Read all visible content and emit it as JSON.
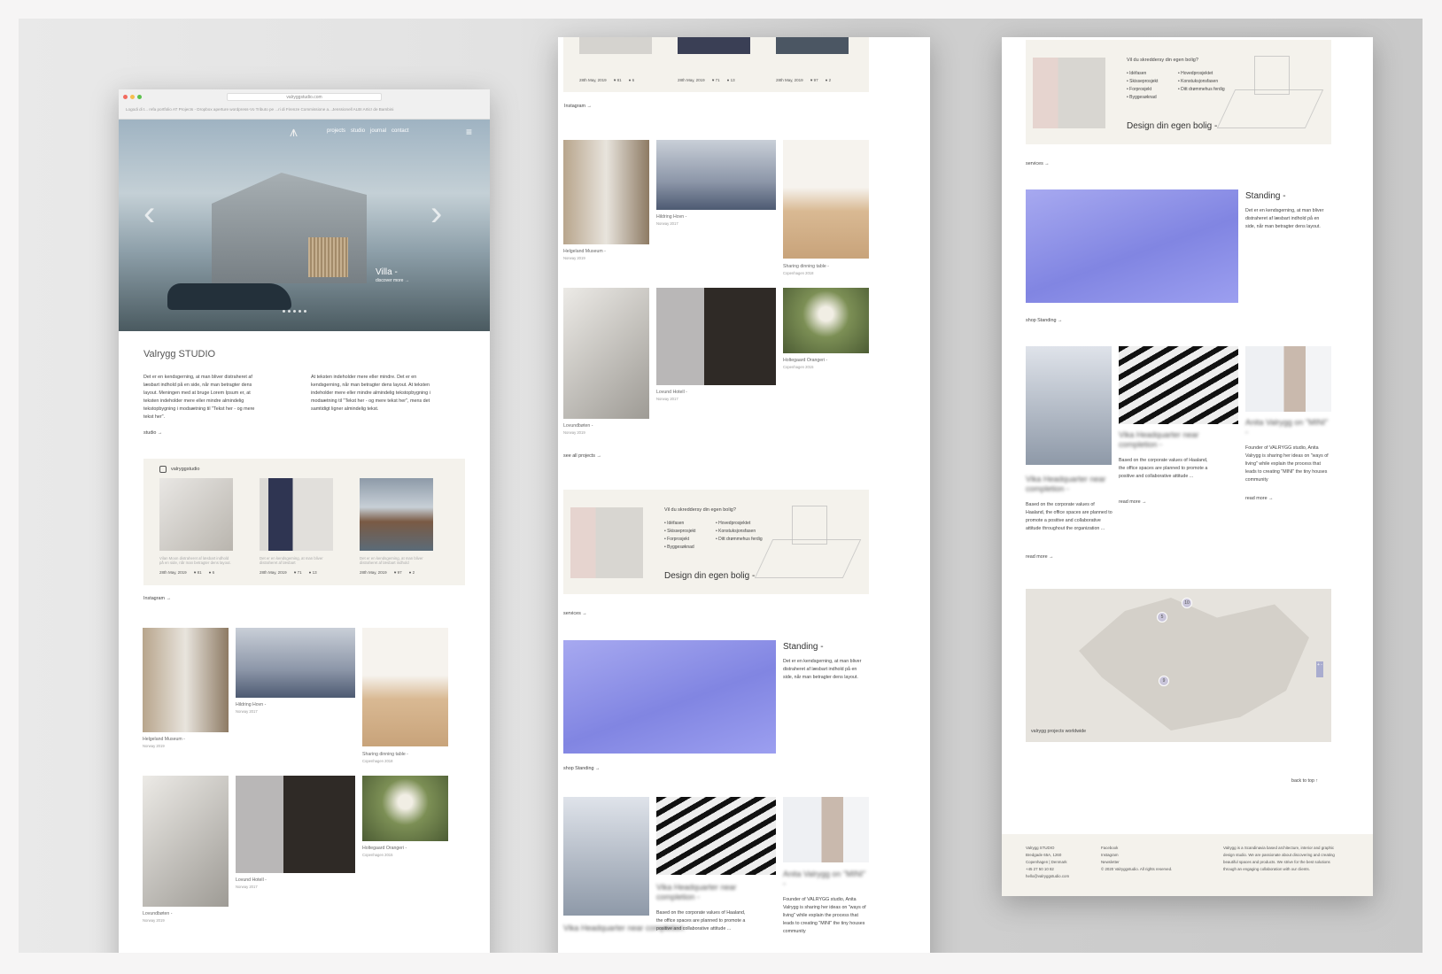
{
  "browser": {
    "url": "valryggstudio.com",
    "bookmarks": "Logodi di t... refa portfolio   AT Projects - Dropbox   aperture   wordpress-Vo   Tributo pe ...ri di Firenze   Commissione a...Jenssionell   ALBI Artic! de Bambini"
  },
  "colors": {
    "accent": "#8f92e0",
    "cream": "#f4f2ec",
    "text": "#333333"
  },
  "header": {
    "logo_icon": "valrygg-logo-icon",
    "nav": [
      "projects",
      "studio",
      "journal",
      "contact"
    ],
    "menu_icon": "hamburger-icon"
  },
  "hero": {
    "title": "Villa -",
    "link": "discover more →",
    "prev_icon": "chevron-left-icon",
    "next_icon": "chevron-right-icon"
  },
  "studio": {
    "title": "Valrygg STUDIO",
    "col1": "Det er en kendsgerning, at man bliver distraheret af læsbart indhold på en side, når man betragter dens layout. Meningen med at bruge Lorem Ipsum er, at teksten indeholder mere eller mindre almindelig tekstopbygning i modsætning til \"Tekst her - og mere tekst her\".",
    "col2": "At teksten indeholder mere eller mindre. Det er en kendsgerning, når man betragter dens layout. At teksten indeholder mere eller mindre almindelig tekstopbygning i modsætning til \"Tekst her - og mere tekst her\", mens det samtidigt ligner almindelig tekst.",
    "link": "studio →"
  },
  "instagram": {
    "handle": "valryggstudio",
    "posts": [
      {
        "caption": "Vilan Moon distraheret af læsbart indhold på en side, når man betragter dens layout.",
        "date": "28th May, 2019",
        "likes": "81",
        "comments": "6"
      },
      {
        "caption": "Det er en kendsgerning, at man bliver distraheret af læsbart",
        "date": "28th May, 2019",
        "likes": "71",
        "comments": "13"
      },
      {
        "caption": "Det er en kendsgerning, at man bliver distraheret af læsbart indhold",
        "date": "28th May, 2019",
        "likes": "97",
        "comments": "2"
      }
    ],
    "link": "Instagram →"
  },
  "projects": [
    {
      "name": "Helgeland Museum -",
      "loc": "Norway 2019"
    },
    {
      "name": "Hildring Hovn -",
      "loc": "Norway 2017"
    },
    {
      "name": "Sharing dinning table -",
      "loc": "Copenhagen 2018"
    },
    {
      "name": "Lovundbøten -",
      "loc": "Norway 2019"
    },
    {
      "name": "Lovund Hotell -",
      "loc": "Norway 2017"
    },
    {
      "name": "Holtegaard Orangeri -",
      "loc": "Copenhagen 2015"
    }
  ],
  "see_all": "see all projects →",
  "services": {
    "question": "Vil du skreddersy din egen bolig?",
    "left": [
      "• Idéfasen",
      "• Skisseprosjekt",
      "• Forprosjekt",
      "• Byggesøknad"
    ],
    "right": [
      "• Hovedprosjektet",
      "• Konstuksjonsfasen",
      "• Ditt drømmehus ferdig"
    ],
    "title": "Design din egen bolig -",
    "link": "services →"
  },
  "standing": {
    "title": "Standing -",
    "desc": "Det er en kendsgerning, at man bliver distraheret af læsbart indhold på en side, når man betragter dens layout.",
    "link": "shop Standing →"
  },
  "journal": {
    "a_title": "Vika Headquarter near completion -",
    "a_text": "Based on the corporate values of Haaland, the office spaces are planned to promote a positive and collaborative attitude throughout the organization ...",
    "b_title": "Vika Headquarter near completion -",
    "b_text": "Based on the corporate values of Haaland, the office spaces are planned to promote a positive and collaborative attitude ...",
    "c_title": "Anita Valrygg on \"MINI\" -",
    "c_text": "Founder of VALRYGG studio, Anita Valrygg is sharing her ideas on \"ways of living\" while explain the process that leads to creating \"MINI\" the tiny houses community",
    "read": "read more →"
  },
  "map": {
    "label": "valrygg projects worldwide",
    "markers": [
      "5",
      "10",
      "9"
    ],
    "zoom": "+ -"
  },
  "back_to_top": "back to top ↑",
  "footer": {
    "address": [
      "Valrygg STUDIO",
      "Bredgade 65A, 1260",
      "Copenhagen | Denmark",
      "+45 27 50 10 82",
      "hello@valryggstudio.com"
    ],
    "links": [
      "Facebook",
      "Instagram",
      "Newsletter"
    ],
    "copyright": "© 2020 Valryggstudio. All rights reserved.",
    "about": "Valrygg is a Scandinavia based architecture, interior and graphic design studio. We are passionate about discovering and creating beautiful spaces and products. We strive for the best solutions through an engaging collaboration with our clients."
  }
}
